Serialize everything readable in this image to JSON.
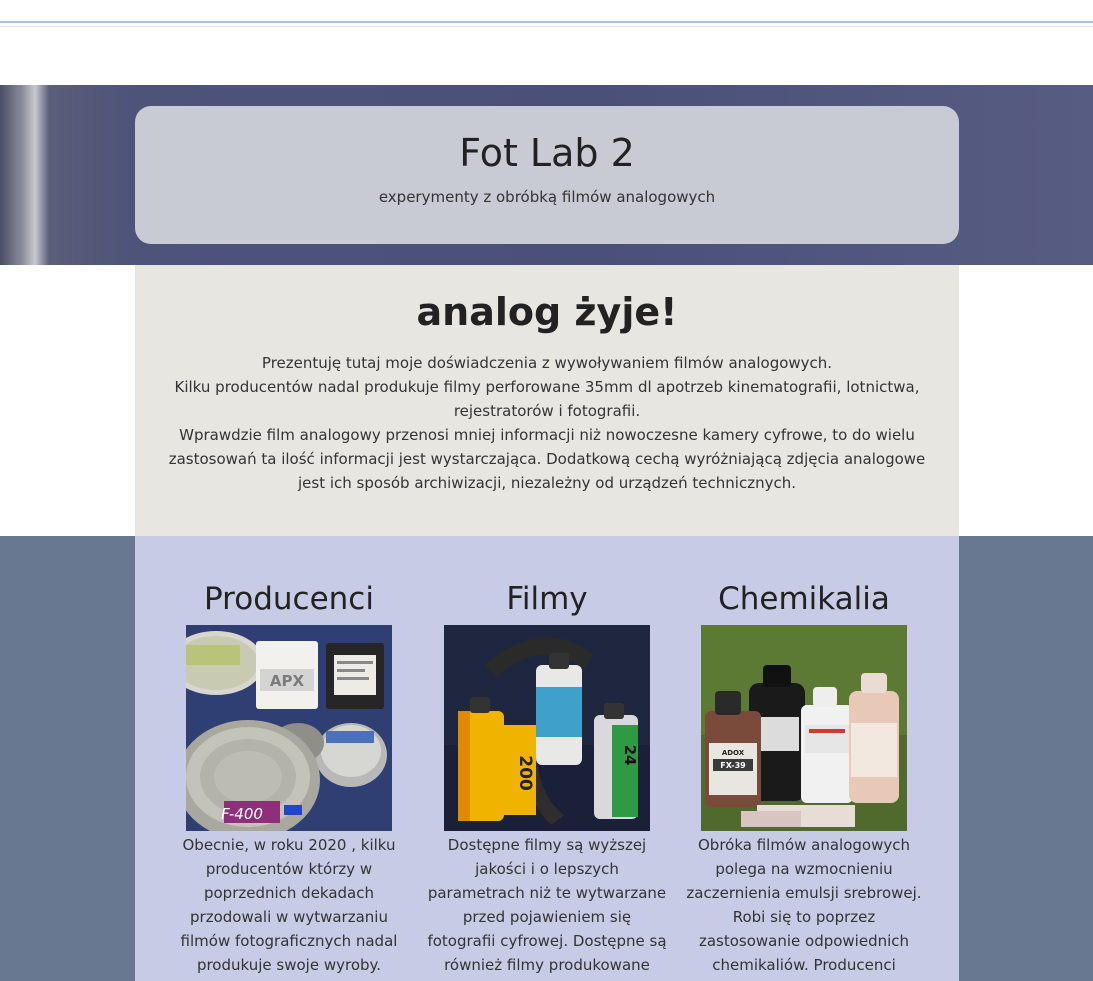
{
  "header": {
    "title": "Fot Lab 2",
    "subtitle": "experymenty z obróbką filmów analogowych"
  },
  "intro": {
    "title": "analog żyje!",
    "paragraphs": [
      "Prezentuję tutaj moje doświadczenia z wywoływaniem filmów analogowych.",
      "Kilku producentów nadal produkuje filmy perforowane 35mm dl apotrzeb kinematografii, lotnictwa, rejestratorów i fotografii.",
      "Wprawdzie film analogowy przenosi mniej informacji niż nowoczesne kamery cyfrowe, to do wielu zastosowań ta ilość informacji jest wystarczająca. Dodatkową cechą wyróżniającą zdjęcia analogowe jest ich sposób archiwizacji, niezależny od urządzeń technicznych."
    ]
  },
  "cards": [
    {
      "title": "Producenci",
      "image": "film-canisters-photo",
      "photo_labels": [
        "APX",
        "F-400"
      ],
      "text": "Obecnie, w roku 2020 , kilku producentów którzy w poprzednich dekadach przodowali w wytwarzaniu filmów fotograficznych nadal produkuje swoje wyroby."
    },
    {
      "title": "Filmy",
      "image": "film-rolls-photo",
      "photo_labels": [
        "200",
        "24"
      ],
      "text": "Dostępne filmy są wyższej jakości i o lepszych parametrach niż te wytwarzane przed pojawieniem się fotografii cyfrowej. Dostępne są również filmy produkowane"
    },
    {
      "title": "Chemikalia",
      "image": "chemical-bottles-photo",
      "photo_labels": [
        "ADOX",
        "FX-39"
      ],
      "text": "Obróka filmów analogowych polega na wzmocnieniu zaczernienia emulsji srebrowej. Robi się to poprzez zastosowanie odpowiednich chemikaliów. Producenci"
    }
  ],
  "colors": {
    "hero_bg": "#4e537a",
    "hero_card": "#c8cad4",
    "intro_bg": "#e8e6e0",
    "lower_bg": "#677890",
    "cards_bg": "#c8cbe6"
  }
}
